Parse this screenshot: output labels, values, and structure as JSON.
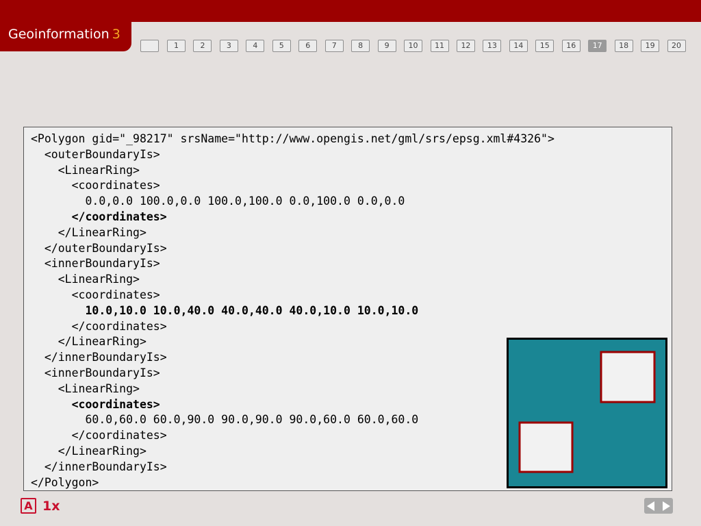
{
  "header": {
    "title": "Geoinformation",
    "number": "3"
  },
  "slide_nav": {
    "current": "17",
    "items": [
      "",
      "1",
      "2",
      "3",
      "4",
      "5",
      "6",
      "7",
      "8",
      "9",
      "10",
      "11",
      "12",
      "13",
      "14",
      "15",
      "16",
      "17",
      "18",
      "19",
      "20"
    ]
  },
  "code": {
    "lines": [
      "<Polygon gid=\"_98217\" srsName=\"http://www.opengis.net/gml/srs/epsg.xml#4326\">",
      "  <outerBoundaryIs>",
      "    <LinearRing>",
      "      <coordinates>",
      "        0.0,0.0 100.0,0.0 100.0,100.0 0.0,100.0 0.0,0.0",
      "      </coordinates>",
      "    </LinearRing>",
      "  </outerBoundaryIs>",
      "  <innerBoundaryIs>",
      "    <LinearRing>",
      "      <coordinates>",
      "        10.0,10.0 10.0,40.0 40.0,40.0 40.0,10.0 10.0,10.0",
      "      </coordinates>",
      "    </LinearRing>",
      "  </innerBoundaryIs>",
      "  <innerBoundaryIs>",
      "    <LinearRing>",
      "      <coordinates>",
      "        60.0,60.0 60.0,90.0 90.0,90.0 90.0,60.0 60.0,60.0",
      "      </coordinates>",
      "    </LinearRing>",
      "  </innerBoundaryIs>",
      "</Polygon>"
    ],
    "bold_lines": [
      5,
      11,
      17
    ]
  },
  "figure": {
    "outer_color": "#1a8694",
    "outline_color": "#000000",
    "hole_color": "#f2f2f2",
    "hole_border_color": "#9c0000"
  },
  "footer": {
    "a_icon_label": "A",
    "zoom_label": "1x"
  },
  "colors": {
    "header_red": "#9c0000",
    "accent_orange": "#f5a623",
    "footer_red": "#c8102e"
  }
}
